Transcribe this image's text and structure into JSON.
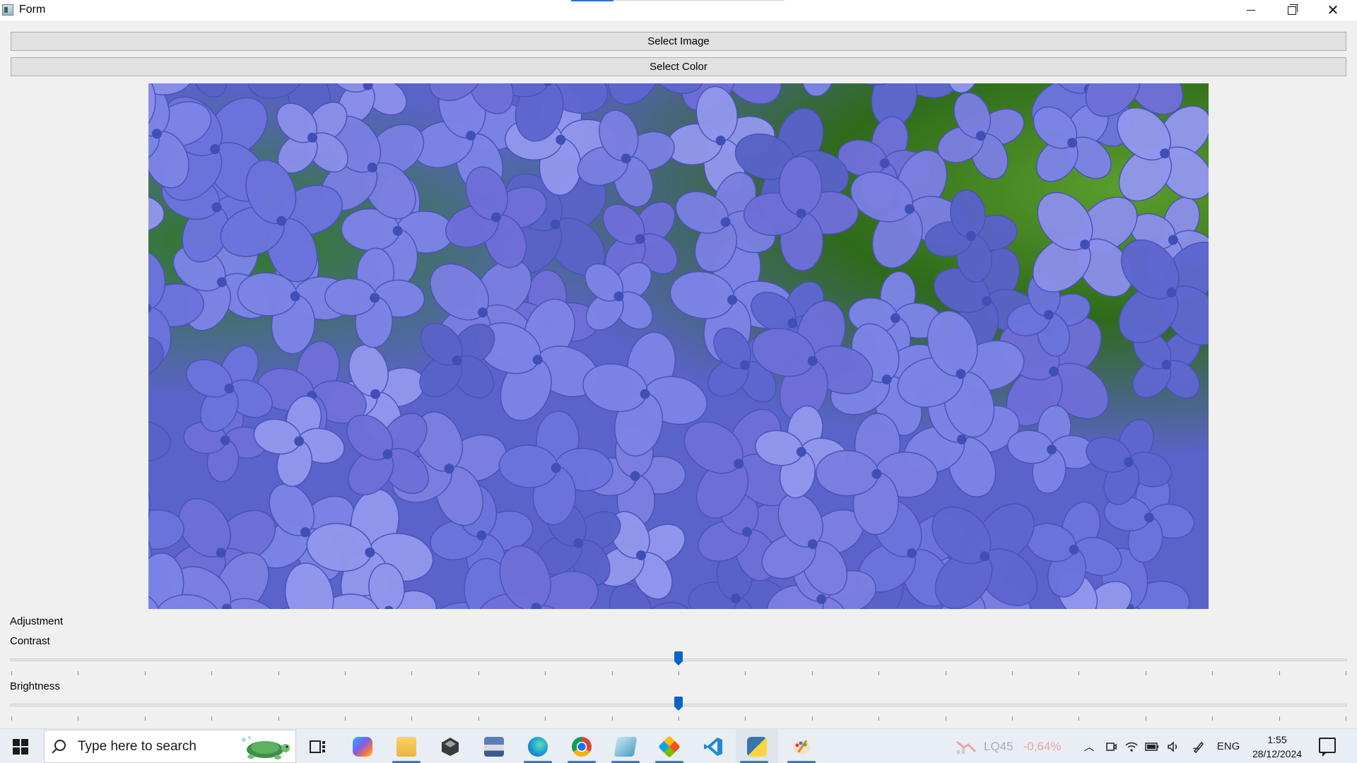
{
  "window": {
    "title": "Form"
  },
  "buttons": {
    "select_image": "Select Image",
    "select_color": "Select Color"
  },
  "image": {
    "alt": "blue hydrangea flowers with pngtree watermark"
  },
  "adjustment": {
    "group_label": "Adjustment",
    "contrast": {
      "label": "Contrast",
      "value_fraction": 0.5,
      "tick_count": 21
    },
    "brightness": {
      "label": "Brightness",
      "value_fraction": 0.5,
      "tick_count": 21
    }
  },
  "taskbar": {
    "search_placeholder": "Type here to search",
    "apps": [
      "task-view",
      "copilot",
      "file-explorer",
      "app-3d",
      "app-scanner",
      "edge",
      "chrome",
      "app-blue",
      "app-colors",
      "vscode",
      "python",
      "paint"
    ],
    "stock": {
      "symbol": "LQ45",
      "change": "-0,64%"
    },
    "tray": {
      "language": "ENG",
      "time": "1:55",
      "date": "28/12/2024"
    }
  },
  "colors": {
    "accent": "#0a64c8",
    "button_bg": "#e1e1e1",
    "window_bg": "#f0f0f0"
  }
}
